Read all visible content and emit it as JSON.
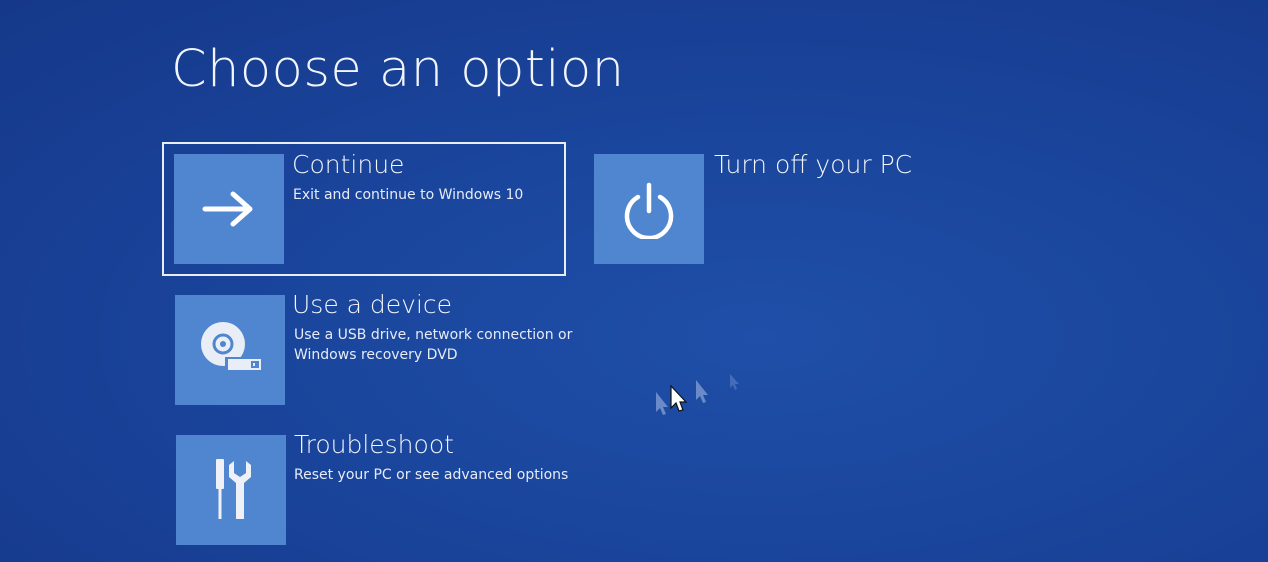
{
  "screen": {
    "title": "Choose an option"
  },
  "options": {
    "continue": {
      "title": "Continue",
      "desc": "Exit and continue to Windows 10",
      "icon": "arrow-right-icon"
    },
    "turn_off": {
      "title": "Turn off your PC",
      "desc": "",
      "icon": "power-icon"
    },
    "use_device": {
      "title": "Use a device",
      "desc_line1": "Use a USB drive, network connection or",
      "desc_line2": "Windows recovery DVD",
      "icon": "disc-usb-icon"
    },
    "troubleshoot": {
      "title": "Troubleshoot",
      "desc": "Reset your PC or see advanced options",
      "icon": "tools-icon"
    }
  },
  "colors": {
    "background": "#1a459c",
    "tile": "#4f86cf",
    "text": "#ffffff"
  }
}
